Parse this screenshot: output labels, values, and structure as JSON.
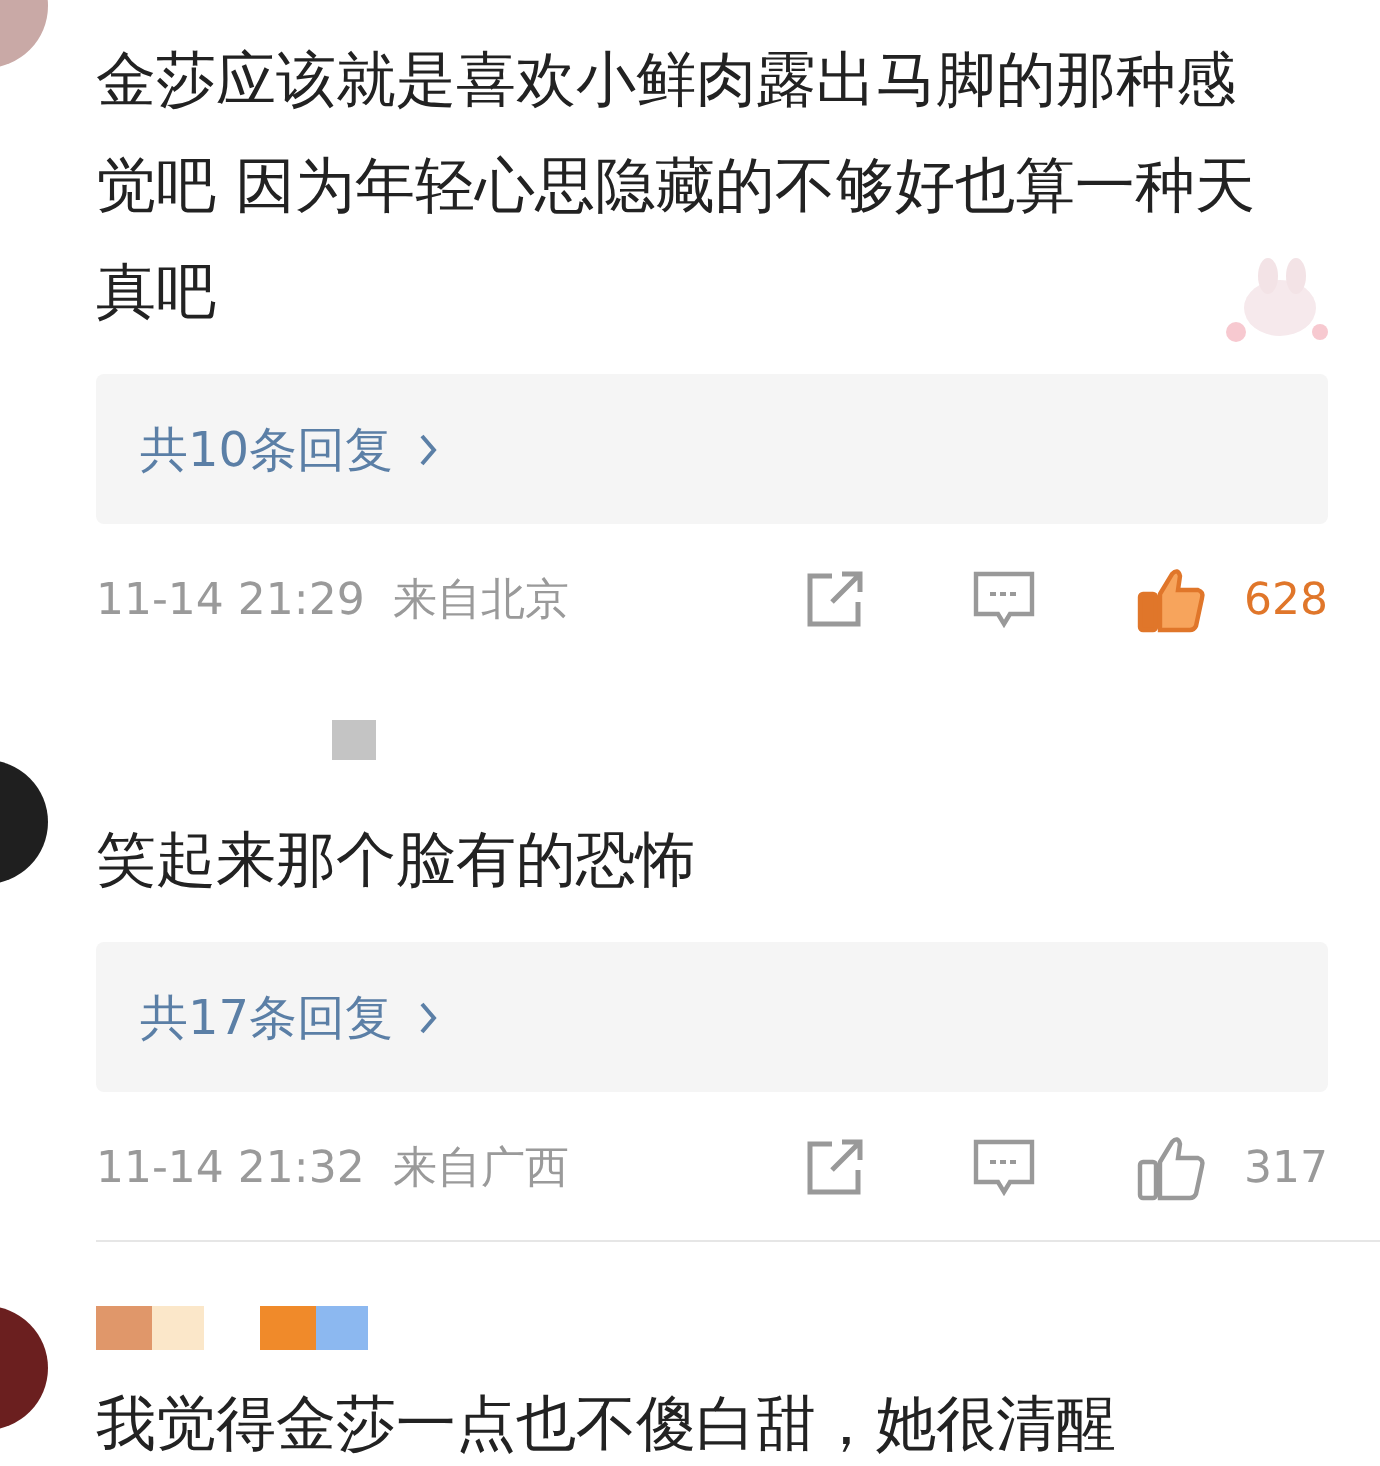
{
  "comments": [
    {
      "text": "金莎应该就是喜欢小鲜肉露出马脚的那种感觉吧 因为年轻心思隐藏的不够好也算一种天真吧",
      "replies": "共10条回复",
      "time": "11-14 21:29",
      "location": "来自北京",
      "likes": "628",
      "liked": true
    },
    {
      "text": "笑起来那个脸有的恐怖",
      "replies": "共17条回复",
      "time": "11-14 21:32",
      "location": "来自广西",
      "likes": "317",
      "liked": false
    },
    {
      "text": "我觉得金莎一点也不傻白甜，她很清醒"
    }
  ]
}
